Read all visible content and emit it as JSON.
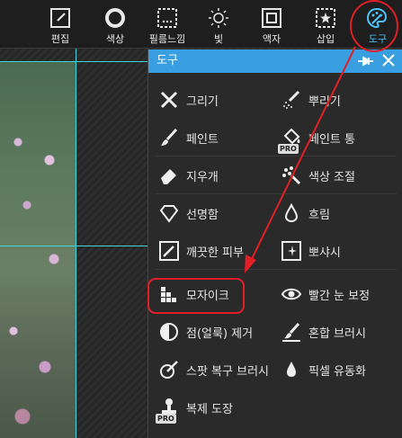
{
  "toolbar": {
    "items": [
      {
        "label": "편집",
        "icon": "edit-icon"
      },
      {
        "label": "색상",
        "icon": "color-circle-icon"
      },
      {
        "label": "필름느낌",
        "icon": "film-icon"
      },
      {
        "label": "빛",
        "icon": "sun-icon"
      },
      {
        "label": "액자",
        "icon": "frame-icon"
      },
      {
        "label": "삽입",
        "icon": "insert-star-icon"
      },
      {
        "label": "도구",
        "icon": "palette-icon"
      }
    ],
    "active_color": "#4fc3f7"
  },
  "panel": {
    "title": "도구",
    "header_color": "#3a9fe0",
    "tools": [
      {
        "label": "그리기",
        "icon": "pencil-cross-icon"
      },
      {
        "label": "뿌리기",
        "icon": "spray-icon"
      },
      {
        "label": "페인트",
        "icon": "brush-icon"
      },
      {
        "label": "페인트 통",
        "icon": "paint-bucket-icon",
        "badge": "PRO"
      },
      {
        "label": "지우개",
        "icon": "eraser-icon"
      },
      {
        "label": "색상 조절",
        "icon": "color-adjust-icon"
      },
      {
        "label": "선명함",
        "icon": "diamond-icon"
      },
      {
        "label": "흐림",
        "icon": "drop-icon"
      },
      {
        "label": "깨끗한 피부",
        "icon": "clean-skin-icon"
      },
      {
        "label": "뽀샤시",
        "icon": "sparkle-icon"
      },
      {
        "label": "모자이크",
        "icon": "mosaic-icon"
      },
      {
        "label": "빨간 눈 보정",
        "icon": "eye-icon"
      },
      {
        "label": "점(얼룩) 제거",
        "icon": "spot-remove-icon"
      },
      {
        "label": "혼합 브러시",
        "icon": "blend-brush-icon"
      },
      {
        "label": "스팟 복구 브러시",
        "icon": "spot-heal-icon"
      },
      {
        "label": "픽셀 유동화",
        "icon": "liquify-icon"
      },
      {
        "label": "복제 도장",
        "icon": "stamp-icon",
        "badge": "PRO"
      }
    ]
  },
  "annotation_color": "#e21f26"
}
